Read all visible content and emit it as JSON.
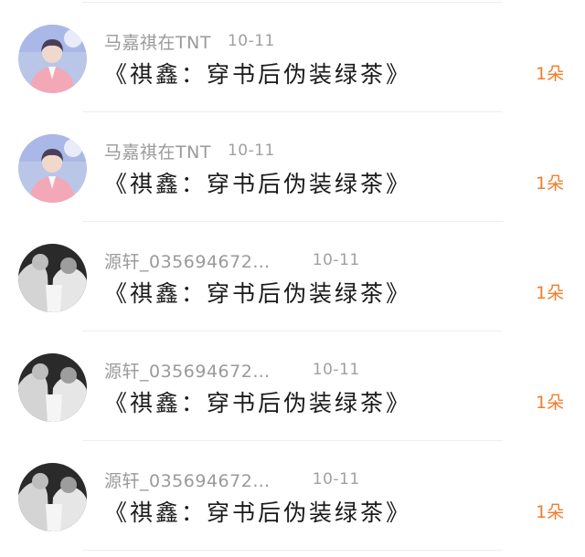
{
  "colors": {
    "username": "#9a9a9a",
    "date": "#a0a0a0",
    "title": "#1a1a1a",
    "count_accent": "#ef7d2c",
    "divider": "#eeeeee"
  },
  "items": [
    {
      "avatar_icon": "avatar-color-photo",
      "username": "马嘉祺在TNT",
      "date": "10-11",
      "title": "《祺鑫：穿书后伪装绿茶》",
      "count": "1朵"
    },
    {
      "avatar_icon": "avatar-color-photo",
      "username": "马嘉祺在TNT",
      "date": "10-11",
      "title": "《祺鑫：穿书后伪装绿茶》",
      "count": "1朵"
    },
    {
      "avatar_icon": "avatar-bw-photo",
      "username": "源轩_035694672…",
      "date": "10-11",
      "title": "《祺鑫：穿书后伪装绿茶》",
      "count": "1朵"
    },
    {
      "avatar_icon": "avatar-bw-photo",
      "username": "源轩_035694672…",
      "date": "10-11",
      "title": "《祺鑫：穿书后伪装绿茶》",
      "count": "1朵"
    },
    {
      "avatar_icon": "avatar-bw-photo",
      "username": "源轩_035694672…",
      "date": "10-11",
      "title": "《祺鑫：穿书后伪装绿茶》",
      "count": "1朵"
    }
  ]
}
